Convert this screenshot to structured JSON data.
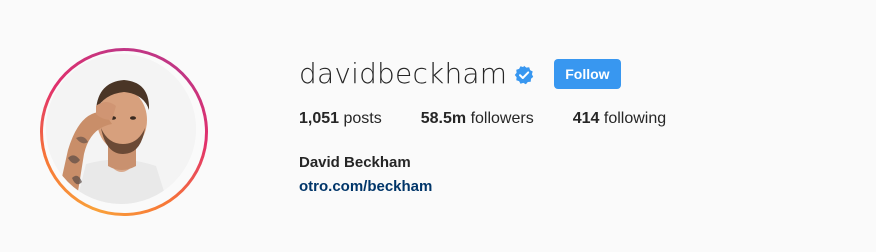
{
  "profile": {
    "username": "davidbeckham",
    "verified_icon": "verified-badge-icon",
    "follow_label": "Follow",
    "stats": {
      "posts_count": "1,051",
      "posts_label": "posts",
      "followers_count": "58.5m",
      "followers_label": "followers",
      "following_count": "414",
      "following_label": "following"
    },
    "full_name": "David Beckham",
    "website": "otro.com/beckham"
  },
  "colors": {
    "follow_button": "#3897f0",
    "link": "#003569",
    "verified": "#3897f0",
    "ring_start": "#f9a13a",
    "ring_end": "#c13584"
  }
}
